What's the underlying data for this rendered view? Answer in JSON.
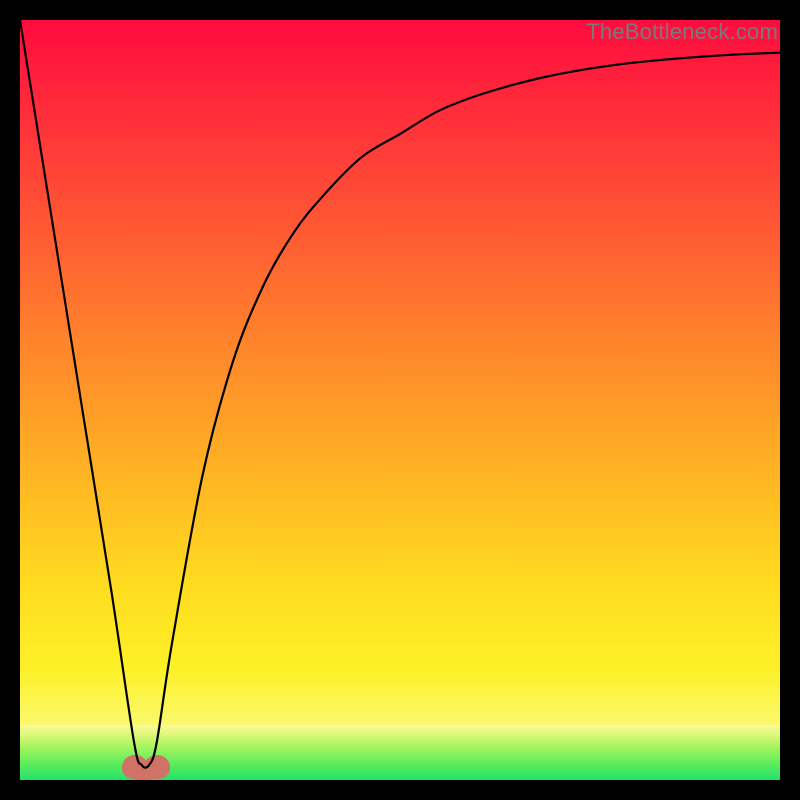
{
  "attribution": "TheBottleneck.com",
  "chart_data": {
    "type": "line",
    "title": "",
    "xlabel": "",
    "ylabel": "",
    "xlim": [
      0,
      100
    ],
    "ylim": [
      0,
      100
    ],
    "grid": false,
    "legend": false,
    "series": [
      {
        "name": "bottleneck-curve",
        "x": [
          0,
          4,
          8,
          12,
          15,
          16,
          17,
          18,
          20,
          24,
          28,
          32,
          36,
          40,
          45,
          50,
          55,
          60,
          65,
          70,
          75,
          80,
          85,
          90,
          95,
          100
        ],
        "y": [
          100,
          75,
          50,
          25,
          5,
          2,
          2,
          5,
          18,
          40,
          55,
          65,
          72,
          77,
          82,
          85,
          88,
          90,
          91.5,
          92.7,
          93.6,
          94.3,
          94.8,
          95.2,
          95.5,
          95.7
        ]
      }
    ],
    "annotations": [
      {
        "name": "sweet-spot-marker",
        "x": 16.5,
        "y": 1.5,
        "shape": "double-lobe",
        "color": "#d07265"
      }
    ],
    "background_gradient": {
      "stops": [
        {
          "pos": 0.0,
          "color": "#ff0b3e"
        },
        {
          "pos": 0.5,
          "color": "#ff8a2a"
        },
        {
          "pos": 0.9,
          "color": "#fdf126"
        },
        {
          "pos": 0.93,
          "color": "#faf86e"
        },
        {
          "pos": 1.0,
          "color": "#22e36b"
        }
      ],
      "green_band_start_frac": 0.928
    }
  }
}
